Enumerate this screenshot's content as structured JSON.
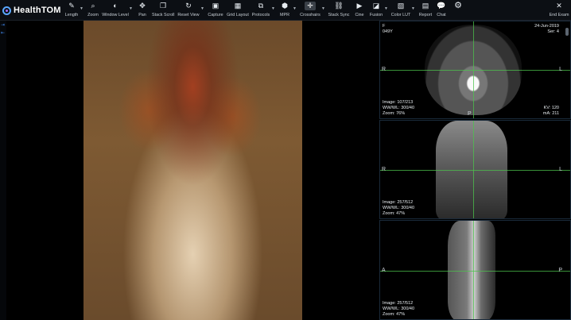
{
  "brand": {
    "name": "HealthTOM"
  },
  "toolbar": {
    "tools": [
      {
        "label": "Length",
        "icon": "pencil-icon",
        "glyph": "✎"
      },
      {
        "label": "Zoom",
        "icon": "zoom-icon",
        "glyph": "⌕"
      },
      {
        "label": "Window Level",
        "icon": "contrast-icon",
        "glyph": "◐"
      },
      {
        "label": "Pan",
        "icon": "pan-icon",
        "glyph": "✥"
      },
      {
        "label": "Stack Scroll",
        "icon": "stack-icon",
        "glyph": "❐"
      },
      {
        "label": "Reset View",
        "icon": "reset-icon",
        "glyph": "↻"
      },
      {
        "label": "Capture",
        "icon": "camera-icon",
        "glyph": "▣"
      },
      {
        "label": "Grid Layout",
        "icon": "grid-icon",
        "glyph": "▦"
      },
      {
        "label": "Protocols",
        "icon": "protocols-icon",
        "glyph": "⧉"
      },
      {
        "label": "MPR",
        "icon": "cube-icon",
        "glyph": "⬢"
      },
      {
        "label": "Crosshairs",
        "icon": "crosshairs-icon",
        "glyph": "✛"
      },
      {
        "label": "Stack Sync",
        "icon": "link-icon",
        "glyph": "⛓"
      },
      {
        "label": "Cine",
        "icon": "play-icon",
        "glyph": "▶"
      },
      {
        "label": "Fusion",
        "icon": "fusion-icon",
        "glyph": "◪"
      },
      {
        "label": "Color LUT",
        "icon": "palette-icon",
        "glyph": "▧"
      },
      {
        "label": "Report",
        "icon": "report-icon",
        "glyph": "▤"
      },
      {
        "label": "Chat",
        "icon": "chat-icon",
        "glyph": "💬"
      }
    ],
    "end_exam": "End Exam"
  },
  "viewports": {
    "axial": {
      "tl": [
        "F",
        "049Y"
      ],
      "tr": [
        "24-Jun-2019",
        "Ser: 4"
      ],
      "bl": [
        "Image: 107/213",
        "WW/WL: 300/40",
        "Zoom: 76%"
      ],
      "br": [
        "KV: 120",
        "mA: 211"
      ],
      "orient_left": "R",
      "orient_right": "L",
      "orient_bottom": "P"
    },
    "coronal": {
      "bl": [
        "Image: 257/512",
        "WW/WL: 300/40",
        "Zoom: 47%"
      ],
      "orient_left": "R",
      "orient_right": "L"
    },
    "sagittal": {
      "bl": [
        "Image: 257/512",
        "WW/WL: 300/40",
        "Zoom: 47%"
      ],
      "orient_left": "A",
      "orient_right": "P"
    }
  },
  "colors": {
    "crosshair": "#4cc34c",
    "accent": "#5aa7ff"
  }
}
